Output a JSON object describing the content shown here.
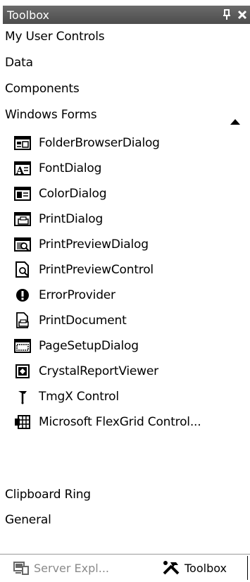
{
  "window": {
    "title": "Toolbox",
    "pin_glyph": "q",
    "close_glyph": "✕"
  },
  "categories": {
    "my_user_controls": "My User Controls",
    "data": "Data",
    "components": "Components",
    "windows_forms": "Windows Forms",
    "clipboard_ring": "Clipboard Ring",
    "general": "General"
  },
  "windows_forms_items": [
    {
      "label": "FolderBrowserDialog",
      "icon": "folder-browser-dialog-icon"
    },
    {
      "label": "FontDialog",
      "icon": "font-dialog-icon"
    },
    {
      "label": "ColorDialog",
      "icon": "color-dialog-icon"
    },
    {
      "label": "PrintDialog",
      "icon": "print-dialog-icon"
    },
    {
      "label": "PrintPreviewDialog",
      "icon": "print-preview-dialog-icon"
    },
    {
      "label": "PrintPreviewControl",
      "icon": "print-preview-control-icon"
    },
    {
      "label": "ErrorProvider",
      "icon": "error-provider-icon"
    },
    {
      "label": "PrintDocument",
      "icon": "print-document-icon"
    },
    {
      "label": "PageSetupDialog",
      "icon": "page-setup-dialog-icon"
    },
    {
      "label": "CrystalReportViewer",
      "icon": "crystal-report-viewer-icon"
    },
    {
      "label": "TmgX Control",
      "icon": "tmgx-control-icon"
    },
    {
      "label": "Microsoft FlexGrid Control...",
      "icon": "flexgrid-control-icon"
    }
  ],
  "bottom_tabs": {
    "server_explorer": "Server Expl...",
    "toolbox": "Toolbox"
  }
}
